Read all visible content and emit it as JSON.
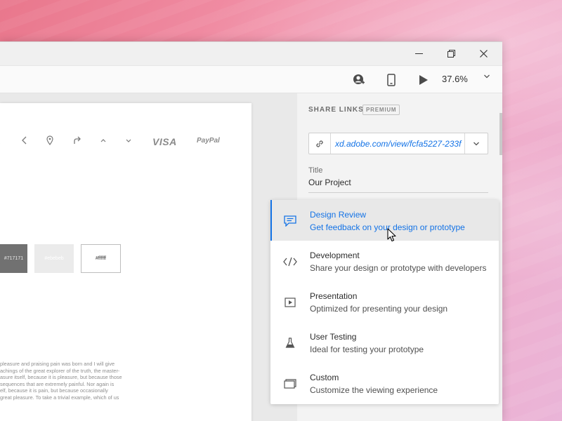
{
  "window": {
    "controls": [
      "minimize",
      "restore",
      "close"
    ]
  },
  "toolbar": {
    "zoom_level": "37.6%"
  },
  "artboard": {
    "payment_logos": [
      "VISA",
      "PayPal"
    ],
    "swatches": [
      "#717171",
      "#ebebeb",
      "#ffffff"
    ],
    "body_text": [
      "pleasure and praising pain was born and I will give",
      "achings of the great explorer of the truth, the master-",
      "asure itself, because it is pleasure, but because those",
      "sequences that are extremely painful. Nor again is",
      "elf, because it is pain, but because occasionally",
      "great pleasure. To take a trivial example, which of us"
    ]
  },
  "share_panel": {
    "header": "SHARE LINKS",
    "badge": "PREMIUM",
    "link_url": "xd.adobe.com/view/fcfa5227-233f",
    "title_label": "Title",
    "title_value": "Our Project"
  },
  "view_options": [
    {
      "icon": "comment-icon",
      "title": "Design Review",
      "desc": "Get feedback on your design or prototype",
      "selected": true
    },
    {
      "icon": "code-icon",
      "title": "Development",
      "desc": "Share your design or prototype with developers",
      "selected": false
    },
    {
      "icon": "play-box-icon",
      "title": "Presentation",
      "desc": "Optimized for presenting your design",
      "selected": false
    },
    {
      "icon": "flask-icon",
      "title": "User Testing",
      "desc": "Ideal for testing your prototype",
      "selected": false
    },
    {
      "icon": "window-icon",
      "title": "Custom",
      "desc": "Customize the viewing experience",
      "selected": false
    }
  ],
  "colors": {
    "accent": "#1473e6",
    "panel_bg": "#f3f3f3",
    "selected_bg": "#e8e8e8"
  }
}
